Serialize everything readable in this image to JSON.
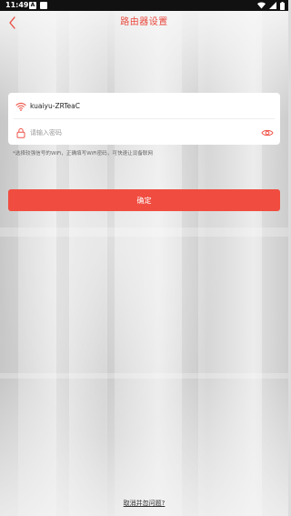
{
  "status_bar": {
    "time": "11:49",
    "notifications": [
      "A",
      ""
    ],
    "icons": [
      "wifi-icon",
      "signal-icon",
      "battery-icon"
    ]
  },
  "header": {
    "title": "路由器设置",
    "back_icon": "chevron-left-icon"
  },
  "form": {
    "ssid": "kuaiyu-ZRTeaC",
    "wifi_icon": "wifi-icon",
    "password_value": "",
    "password_placeholder": "请输入密码",
    "lock_icon": "lock-icon",
    "visibility_icon": "eye-icon"
  },
  "hint": "*选择较强信号的WiFi，正确填写WiFi密码，可快速让设备联网",
  "confirm_label": "确定",
  "bottom_link": "取消并忽问题?",
  "colors": {
    "accent": "#f04d40",
    "title": "#e9483c",
    "status_bar": "#111111"
  }
}
